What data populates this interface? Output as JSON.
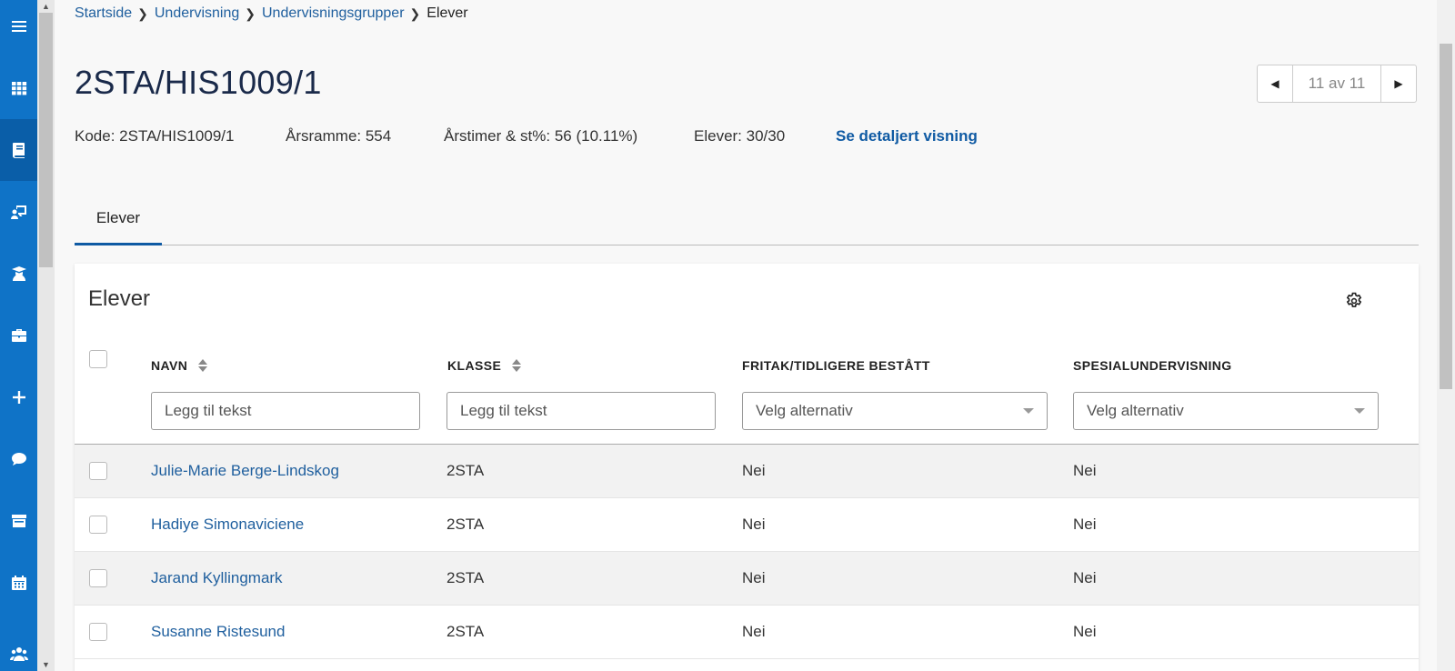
{
  "breadcrumb": [
    {
      "label": "Startside"
    },
    {
      "label": "Undervisning"
    },
    {
      "label": "Undervisningsgrupper"
    }
  ],
  "breadcrumb_current": "Elever",
  "page_title": "2STA/HIS1009/1",
  "pager": {
    "label": "11 av 11"
  },
  "info": {
    "kode": "Kode: 2STA/HIS1009/1",
    "arsramme": "Årsramme: 554",
    "arstimer": "Årstimer & st%: 56 (10.11%)",
    "elever": "Elever: 30/30",
    "detail_link": "Se detaljert visning"
  },
  "tabs": [
    {
      "label": "Elever",
      "active": true
    }
  ],
  "card": {
    "title": "Elever",
    "columns": [
      {
        "label": "NAVN",
        "sortable": true
      },
      {
        "label": "KLASSE",
        "sortable": true
      },
      {
        "label": "FRITAK/TIDLIGERE BESTÅTT",
        "sortable": false
      },
      {
        "label": "SPESIALUNDERVISNING",
        "sortable": false
      }
    ],
    "filters": {
      "navn_placeholder": "Legg til tekst",
      "klasse_placeholder": "Legg til tekst",
      "fritak_value": "Velg alternativ",
      "spesial_value": "Velg alternativ"
    },
    "rows": [
      {
        "navn": "Julie-Marie Berge-Lindskog",
        "klasse": "2STA",
        "fritak": "Nei",
        "spesial": "Nei"
      },
      {
        "navn": "Hadiye Simonaviciene",
        "klasse": "2STA",
        "fritak": "Nei",
        "spesial": "Nei"
      },
      {
        "navn": "Jarand Kyllingmark",
        "klasse": "2STA",
        "fritak": "Nei",
        "spesial": "Nei"
      },
      {
        "navn": "Susanne Ristesund",
        "klasse": "2STA",
        "fritak": "Nei",
        "spesial": "Nei"
      }
    ]
  },
  "nav_icons": [
    "menu-icon",
    "apps-grid-icon",
    "book-icon",
    "teacher-board-icon",
    "student-icon",
    "briefcase-icon",
    "plus-icon",
    "chat-icon",
    "archive-icon",
    "calendar-icon",
    "group-icon"
  ],
  "colors": {
    "rail": "#0f73c7",
    "link": "#1f5f9e",
    "accent": "#0f5aa3"
  }
}
